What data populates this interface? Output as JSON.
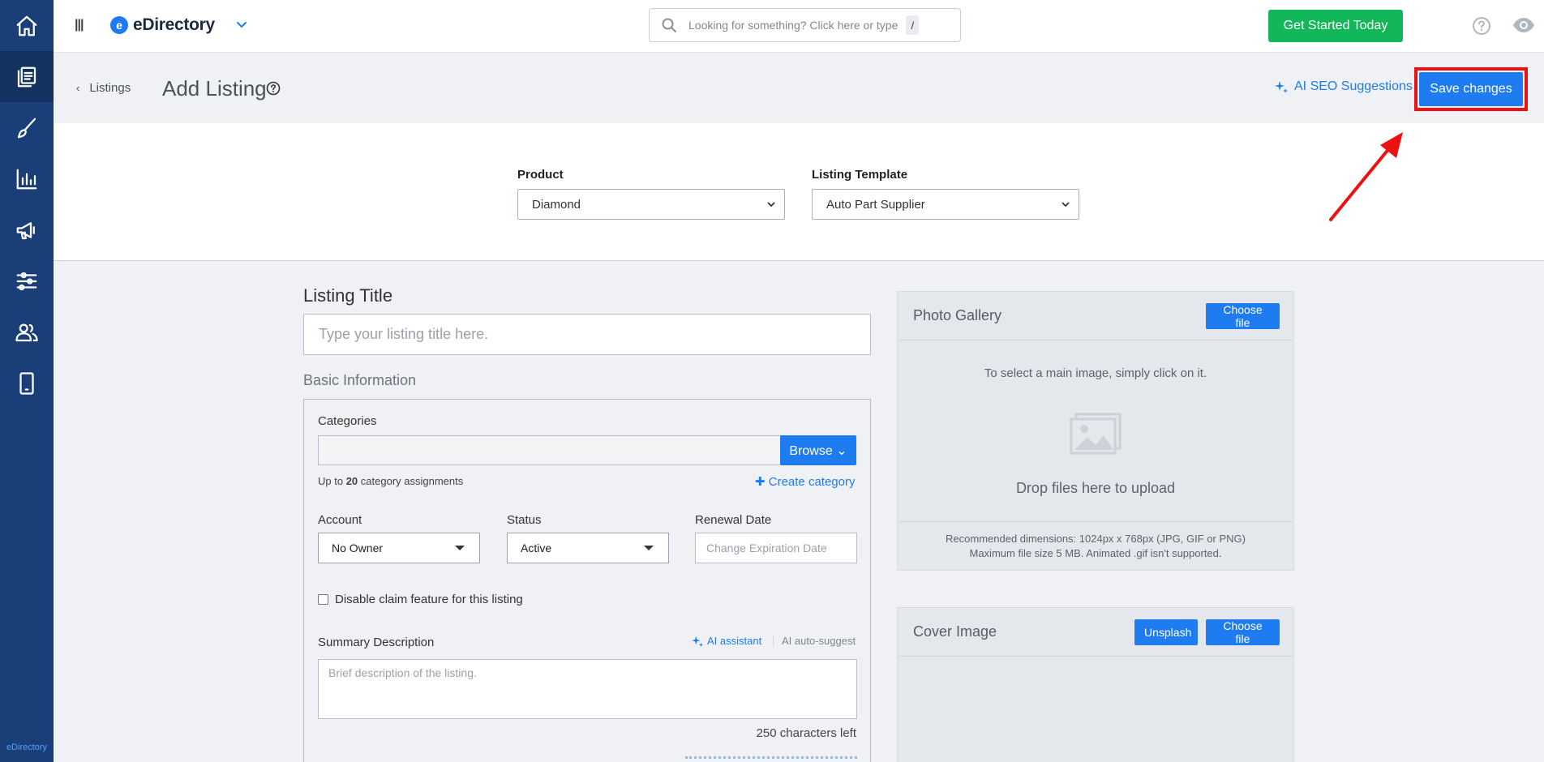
{
  "sidebar": {
    "items": [
      {
        "name": "home",
        "icon": "home-icon"
      },
      {
        "name": "content",
        "icon": "copy-icon",
        "active": true
      },
      {
        "name": "design",
        "icon": "brush-icon"
      },
      {
        "name": "reports",
        "icon": "chart-icon"
      },
      {
        "name": "marketing",
        "icon": "megaphone-icon"
      },
      {
        "name": "settings",
        "icon": "sliders-icon"
      },
      {
        "name": "users",
        "icon": "users-icon"
      },
      {
        "name": "mobile",
        "icon": "phone-icon"
      }
    ],
    "brand": "eDirectory"
  },
  "topbar": {
    "logo_mark": "e",
    "logo_text": "eDirectory",
    "search_placeholder": "Looking for something? Click here or type",
    "search_shortcut": "/",
    "cta_label": "Get Started Today"
  },
  "header": {
    "back_label": "Listings",
    "title": "Add Listing",
    "ai_seo_label": "AI SEO Suggestions",
    "save_label": "Save changes"
  },
  "band": {
    "product_label": "Product",
    "product_value": "Diamond",
    "template_label": "Listing Template",
    "template_value": "Auto Part Supplier"
  },
  "form": {
    "listing_title_label": "Listing Title",
    "listing_title_placeholder": "Type your listing title here.",
    "basic_info_label": "Basic Information",
    "categories_label": "Categories",
    "browse_label": "Browse",
    "upto_prefix": "Up to",
    "upto_count": "20",
    "upto_suffix": "category assignments",
    "create_category_label": "Create category",
    "account_label": "Account",
    "account_value": "No Owner",
    "status_label": "Status",
    "status_value": "Active",
    "renewal_label": "Renewal Date",
    "renewal_placeholder": "Change Expiration Date",
    "claim_label": "Disable claim feature for this listing",
    "summary_label": "Summary Description",
    "ai_assistant_label": "AI assistant",
    "ai_autosuggest_label": "AI auto-suggest",
    "summary_placeholder": "Brief description of the listing.",
    "chars_left": "250 characters left"
  },
  "gallery": {
    "title": "Photo Gallery",
    "choose_label": "Choose file",
    "hint": "To select a main image, simply click on it.",
    "drop_label": "Drop files here to upload",
    "footer_line1": "Recommended dimensions: 1024px x 768px (JPG, GIF or PNG)",
    "footer_line2": "Maximum file size 5 MB. Animated .gif isn't supported."
  },
  "cover": {
    "title": "Cover Image",
    "unsplash_label": "Unsplash",
    "choose_label": "Choose file"
  },
  "colors": {
    "sidebar": "#1a3e78",
    "accent": "#1e7cf0",
    "green": "#12b75a",
    "highlight": "#ee1111"
  }
}
